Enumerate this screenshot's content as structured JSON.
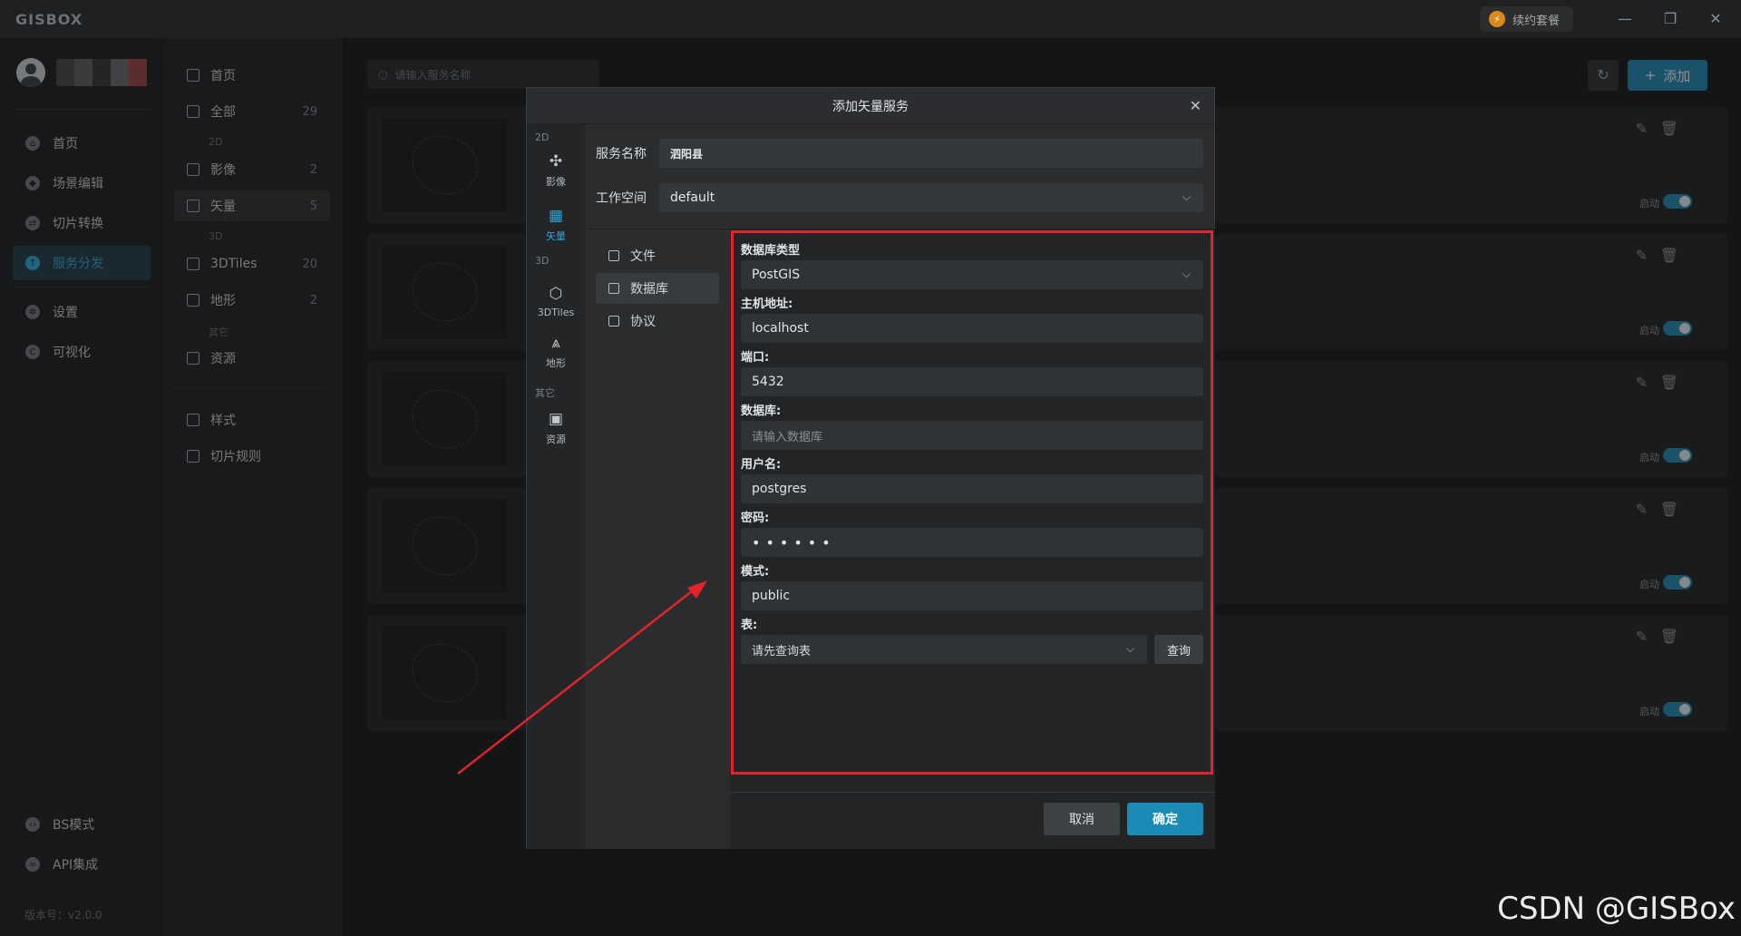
{
  "app": {
    "logo": "GISBOX",
    "renew_label": "续约套餐"
  },
  "window": {
    "minimize": "—",
    "restore": "❐",
    "close": "✕"
  },
  "sidebar": {
    "items": [
      {
        "label": "首页",
        "icon": "home-icon"
      },
      {
        "label": "场景编辑",
        "icon": "cube-icon"
      },
      {
        "label": "切片转换",
        "icon": "convert-icon"
      },
      {
        "label": "服务分发",
        "icon": "upload-icon",
        "active": true
      },
      {
        "label": "设置",
        "icon": "gear-icon"
      },
      {
        "label": "可视化",
        "icon": "chart-icon"
      }
    ],
    "bottom": [
      {
        "label": "BS模式",
        "icon": "code-icon"
      },
      {
        "label": "API集成",
        "icon": "link-icon"
      }
    ],
    "version": "版本号：v2.0.0"
  },
  "panel2": {
    "home": "首页",
    "all": {
      "label": "全部",
      "count": "29"
    },
    "group_2d": "2D",
    "imagery": {
      "label": "影像",
      "count": "2"
    },
    "vector": {
      "label": "矢量",
      "count": "5"
    },
    "group_3d": "3D",
    "tiles3d": {
      "label": "3DTiles",
      "count": "20"
    },
    "terrain": {
      "label": "地形",
      "count": "2"
    },
    "group_other": "其它",
    "resource": {
      "label": "资源"
    },
    "style": "样式",
    "tile_rules": "切片规则"
  },
  "main": {
    "search_placeholder": "请输入服务名称",
    "add_label": "添加",
    "toggle_label": "启动"
  },
  "modal": {
    "title": "添加矢量服务",
    "service_name_label": "服务名称",
    "service_name_value": "泗阳县",
    "workspace_label": "工作空间",
    "workspace_value": "default",
    "rail": {
      "group_2d": "2D",
      "imagery": "影像",
      "vector": "矢量",
      "group_3d": "3D",
      "tiles3d": "3DTiles",
      "terrain": "地形",
      "group_other": "其它",
      "resource": "资源"
    },
    "sources": {
      "file": "文件",
      "database": "数据库",
      "protocol": "协议"
    },
    "db": {
      "type_label": "数据库类型",
      "type_value": "PostGIS",
      "host_label": "主机地址:",
      "host_value": "localhost",
      "port_label": "端口:",
      "port_value": "5432",
      "database_label": "数据库:",
      "database_placeholder": "请输入数据库",
      "user_label": "用户名:",
      "user_value": "postgres",
      "password_label": "密码:",
      "password_value": "••••••",
      "schema_label": "模式:",
      "schema_value": "public",
      "table_label": "表:",
      "table_placeholder": "请先查询表",
      "query_label": "查询"
    },
    "cancel_label": "取消",
    "ok_label": "确定"
  },
  "watermark": "CSDN @GISBox",
  "colors": {
    "accent": "#1f86b1",
    "highlight": "#e3232b",
    "background": "#141516"
  }
}
